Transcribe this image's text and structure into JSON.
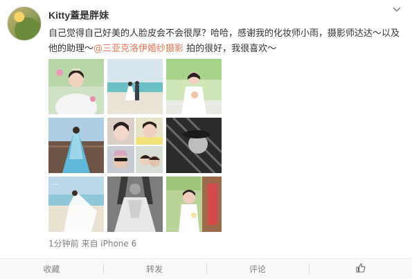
{
  "post": {
    "username": "Kitty蓋是胖妹",
    "text_before": "自己觉得自己好美的人脸皮会不会很厚？哈哈，感谢我的化妆师小雨，摄影师达达～以及他的助理～",
    "mention": "@三亚克洛伊婚纱摄影",
    "text_after": " 拍的很好，我很喜欢～",
    "meta": "1分钟前 来自 iPhone 6"
  },
  "photos": [
    {
      "name": "photo-bride-tiara"
    },
    {
      "name": "photo-couple-beach"
    },
    {
      "name": "photo-bride-bouquet"
    },
    {
      "name": "photo-blue-gown-pier"
    },
    {
      "name": "photo-collage"
    },
    {
      "name": "photo-bw-hat"
    },
    {
      "name": "photo-beach-veil"
    },
    {
      "name": "photo-bw-gown"
    },
    {
      "name": "photo-bride-garden"
    }
  ],
  "actions": {
    "favorite": "收藏",
    "repost": "转发",
    "comment": "评论"
  },
  "icons": {
    "menu": "chevron-down-icon",
    "like": "thumbs-up-icon"
  },
  "colors": {
    "mention": "#eb7350",
    "meta": "#808080"
  }
}
